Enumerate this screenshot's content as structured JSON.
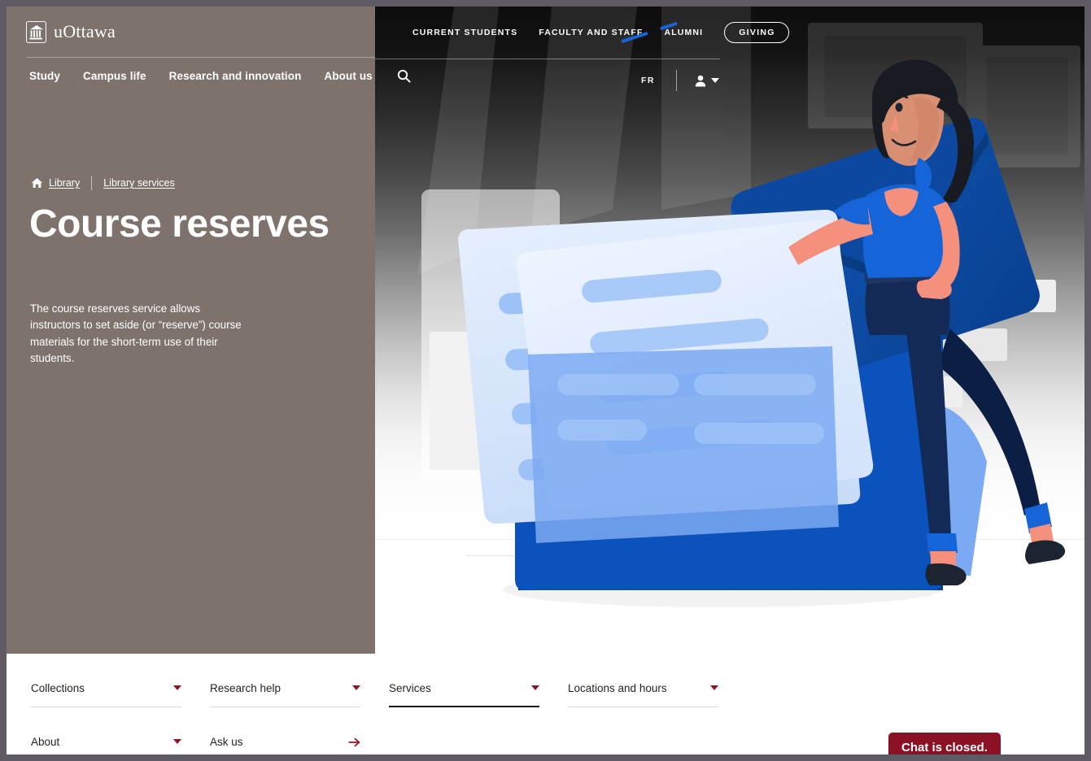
{
  "brand": {
    "name": "uOttawa",
    "logo_icon": "uottawa-building-icon"
  },
  "utility_nav": {
    "links": [
      {
        "label": "CURRENT STUDENTS"
      },
      {
        "label": "FACULTY AND STAFF"
      },
      {
        "label": "ALUMNI"
      }
    ],
    "giving_label": "GIVING"
  },
  "main_nav": {
    "items": [
      {
        "label": "Study"
      },
      {
        "label": "Campus life"
      },
      {
        "label": "Research and innovation"
      },
      {
        "label": "About us"
      }
    ],
    "search_icon": "search-icon"
  },
  "hero_actions": {
    "language_label": "FR",
    "account_icon": "user-account-icon",
    "caret_icon": "chevron-down-icon"
  },
  "breadcrumb": {
    "home_icon": "home-icon",
    "items": [
      {
        "label": "Library"
      },
      {
        "label": "Library services"
      }
    ]
  },
  "hero": {
    "title": "Course reserves",
    "description": "The course reserves service allows instructors to set aside (or “reserve”) course materials for the short-term use of their students."
  },
  "bottom_nav": {
    "row1": [
      {
        "label": "Collections",
        "icon": "chevron-down-icon",
        "active": false
      },
      {
        "label": "Research help",
        "icon": "chevron-down-icon",
        "active": false
      },
      {
        "label": "Services",
        "icon": "chevron-down-icon",
        "active": true
      },
      {
        "label": "Locations and hours",
        "icon": "chevron-down-icon",
        "active": false
      }
    ],
    "row2": [
      {
        "label": "About",
        "icon": "chevron-down-icon"
      },
      {
        "label": "Ask us",
        "icon": "arrow-right-icon"
      }
    ]
  },
  "chat": {
    "label": "Chat is closed."
  },
  "colors": {
    "sidebar": "#7d736c",
    "accent_red": "#8a1426",
    "chat_bg": "#8b1225",
    "illustration_blue": "#0a52b5",
    "page_border": "#5f5a63"
  }
}
